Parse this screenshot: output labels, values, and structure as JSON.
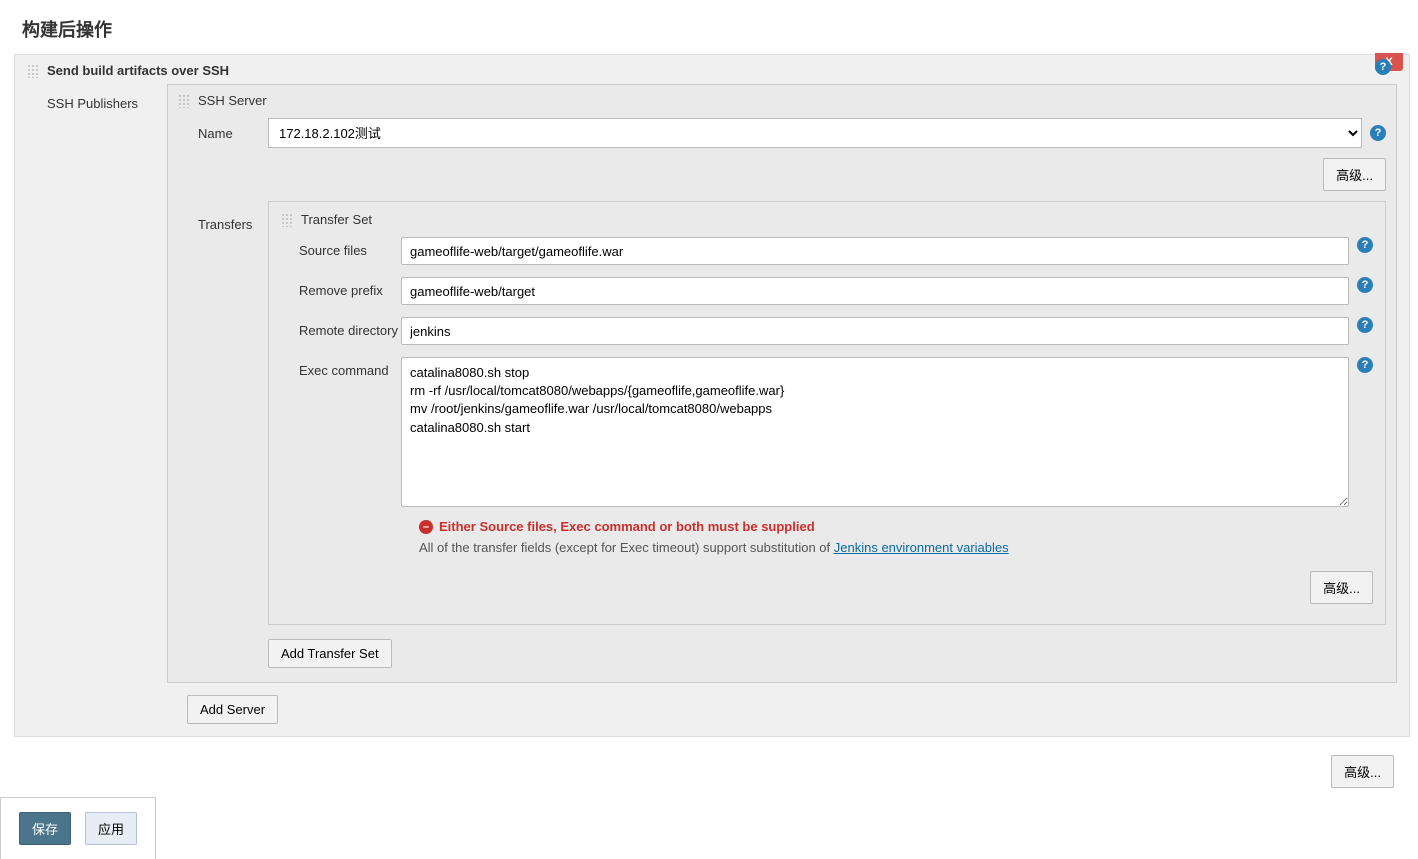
{
  "page": {
    "title": "构建后操作"
  },
  "section": {
    "title": "Send build artifacts over SSH",
    "close_label": "X",
    "ssh_publishers_label": "SSH Publishers",
    "ssh_server_label": "SSH Server",
    "name_label": "Name",
    "name_value": "172.18.2.102测试",
    "advanced_label": "高级...",
    "transfers_label": "Transfers",
    "transfer_set_label": "Transfer Set",
    "source_files_label": "Source files",
    "source_files_value": "gameoflife-web/target/gameoflife.war",
    "remove_prefix_label": "Remove prefix",
    "remove_prefix_value": "gameoflife-web/target",
    "remote_directory_label": "Remote directory",
    "remote_directory_value": "jenkins",
    "exec_command_label": "Exec command",
    "exec_command_value": "catalina8080.sh stop\nrm -rf /usr/local/tomcat8080/webapps/{gameoflife,gameoflife.war}\nmv /root/jenkins/gameoflife.war /usr/local/tomcat8080/webapps\ncatalina8080.sh start",
    "error_message": "Either Source files, Exec command or both must be supplied",
    "info_prefix": "All of the transfer fields (except for Exec timeout) support substitution of ",
    "info_link": "Jenkins environment variables",
    "add_transfer_set_label": "Add Transfer Set",
    "add_server_label": "Add Server",
    "help_glyph": "?",
    "error_glyph": "⛔"
  },
  "footer": {
    "save_label": "保存",
    "apply_label": "应用"
  }
}
